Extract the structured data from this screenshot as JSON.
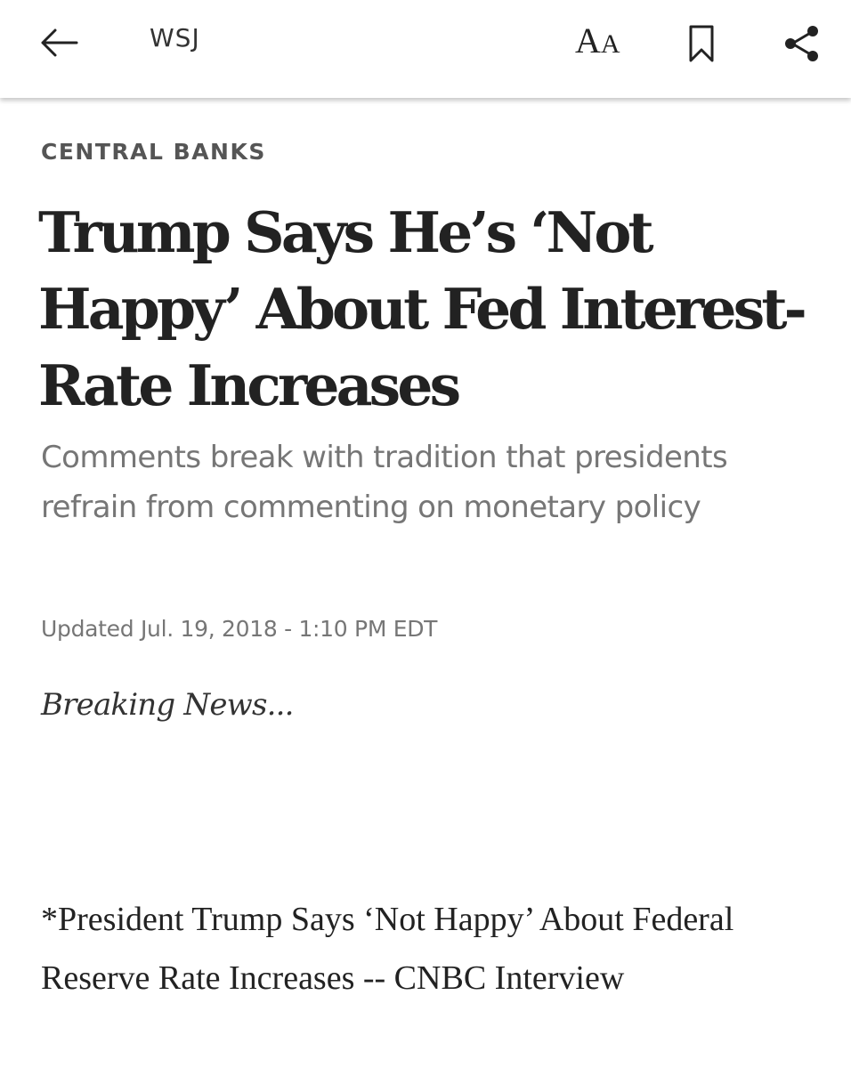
{
  "header": {
    "brand": "WSJ",
    "back_icon": "arrow-left-icon",
    "text_size": {
      "big": "A",
      "small": "A"
    },
    "bookmark_icon": "bookmark-icon",
    "share_icon": "share-icon"
  },
  "article": {
    "section": "CENTRAL BANKS",
    "headline": "Trump Says He’s ‘Not Happy’ About Fed Interest-Rate Increases",
    "dek": "Comments break with tradition that presidents refrain from commenting on monetary policy",
    "timestamp": "Updated Jul. 19, 2018 - 1:10 PM EDT",
    "breaking": "Breaking News...",
    "body": "*President Trump Says ‘Not Happy’ About Federal Reserve Rate Increases -- CNBC Interview"
  },
  "colors": {
    "text": "#222222",
    "muted": "#767676",
    "section": "#555555"
  }
}
